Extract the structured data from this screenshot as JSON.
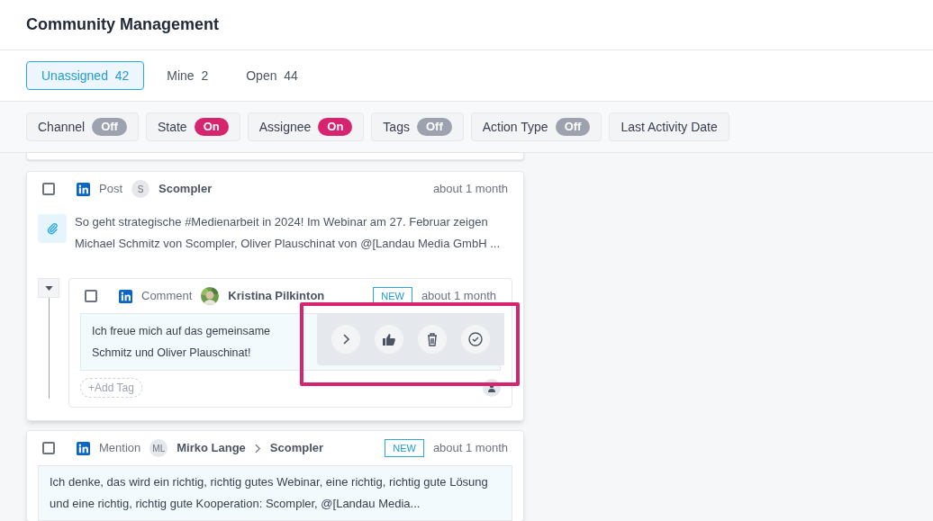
{
  "page_title": "Community Management",
  "tabs": [
    {
      "label": "Unassigned",
      "count": "42",
      "selected": true
    },
    {
      "label": "Mine",
      "count": "2",
      "selected": false
    },
    {
      "label": "Open",
      "count": "44",
      "selected": false
    }
  ],
  "filters": [
    {
      "label": "Channel",
      "toggle": "Off",
      "on": false
    },
    {
      "label": "State",
      "toggle": "On",
      "on": true
    },
    {
      "label": "Assignee",
      "toggle": "On",
      "on": true
    },
    {
      "label": "Tags",
      "toggle": "Off",
      "on": false
    },
    {
      "label": "Action Type",
      "toggle": "Off",
      "on": false
    },
    {
      "label": "Last Activity Date"
    }
  ],
  "post": {
    "checked": false,
    "type": "Post",
    "avatar": "S",
    "author": "Scompler",
    "time": "about 1 month",
    "text": "So geht strategische #Medienarbeit in 2024! Im Webinar am 27. Februar zeigen Michael Schmitz von Scompler, Oliver Plauschinat von @[Landau Media GmbH ...",
    "comment": {
      "checked": false,
      "expanded": true,
      "type": "Comment",
      "author": "Kristina Pilkinton",
      "badge": "NEW",
      "time": "about 1 month",
      "text_lines": [
        "Ich freue mich auf das gemeinsame",
        "Schmitz und Oliver Plauschinat!"
      ],
      "add_tag": "+Add Tag"
    }
  },
  "mention": {
    "checked": false,
    "type": "Mention",
    "avatar": "ML",
    "author": "Mirko Lange",
    "target": "Scompler",
    "badge": "NEW",
    "time": "about 1 month",
    "text": "Ich denke, das wird ein richtig, richtig gutes Webinar, eine richtig, richtig gute Lösung und eine richtig, richtig gute Kooperation: Scompler, @[Landau Media..."
  }
}
